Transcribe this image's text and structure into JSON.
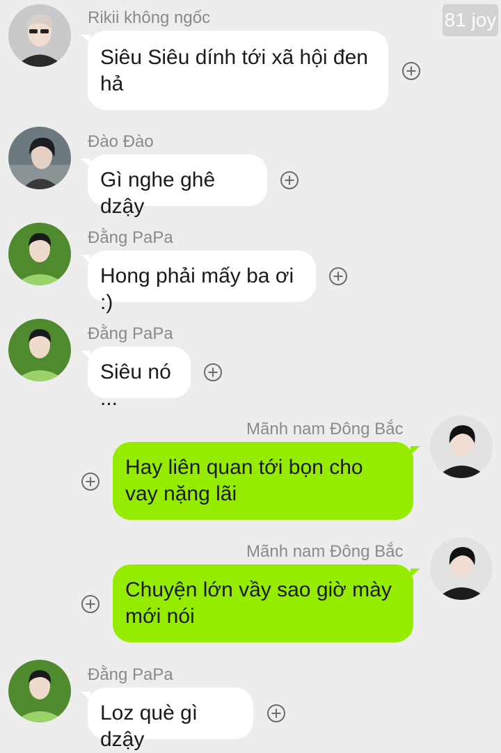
{
  "watermark": "81 joy",
  "colors": {
    "background": "#ededed",
    "incoming_bubble": "#ffffff",
    "outgoing_bubble": "#95ec00",
    "sender_name": "#8a8a8a"
  },
  "messages": [
    {
      "sender": "Rikii không ngốc",
      "text": "Siêu Siêu dính tới xã hội đen hả",
      "direction": "incoming",
      "avatar": "avatar-icon"
    },
    {
      "sender": "Đào Đào",
      "text": "Gì nghe ghê dzậy",
      "direction": "incoming",
      "avatar": "avatar-icon"
    },
    {
      "sender": "Đằng PaPa",
      "text": "Hong phải mấy ba ơi :)",
      "direction": "incoming",
      "avatar": "avatar-icon"
    },
    {
      "sender": "Đằng PaPa",
      "text": "Siêu nó ...",
      "direction": "incoming",
      "avatar": "avatar-icon"
    },
    {
      "sender": "Mãnh nam Đông Bắc",
      "text": "Hay liên quan tới bọn cho vay nặng lãi",
      "direction": "outgoing",
      "avatar": "avatar-icon"
    },
    {
      "sender": "Mãnh nam Đông Bắc",
      "text": "Chuyện lớn vầy sao giờ mày mới nói",
      "direction": "outgoing",
      "avatar": "avatar-icon"
    },
    {
      "sender": "Đằng PaPa",
      "text": "Loz què gì dzậy",
      "direction": "incoming",
      "avatar": "avatar-icon"
    }
  ]
}
